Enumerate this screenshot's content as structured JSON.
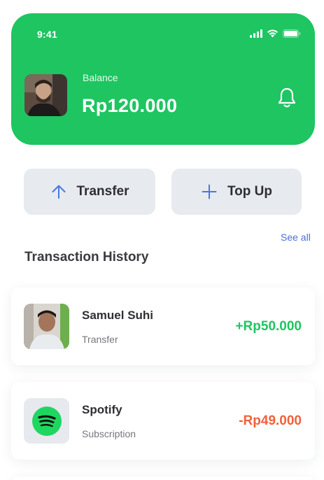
{
  "status_bar": {
    "time": "9:41"
  },
  "header": {
    "balance_label": "Balance",
    "balance_value": "Rp120.000",
    "accent_color": "#1ec561"
  },
  "actions": {
    "transfer_label": "Transfer",
    "topup_label": "Top Up"
  },
  "history": {
    "see_all_label": "See all",
    "title": "Transaction History",
    "items": [
      {
        "name": "Samuel Suhi",
        "type": "Transfer",
        "amount": "+Rp50.000",
        "kind": "incoming"
      },
      {
        "name": "Spotify",
        "type": "Subscription",
        "amount": "-Rp49.000",
        "kind": "outgoing"
      }
    ]
  },
  "icons": {
    "notification": "bell-icon",
    "transfer": "arrow-up-icon",
    "topup": "plus-icon",
    "spotify": "spotify-icon"
  },
  "colors": {
    "positive": "#1ec561",
    "negative": "#f2603a",
    "link": "#4a6de0"
  }
}
